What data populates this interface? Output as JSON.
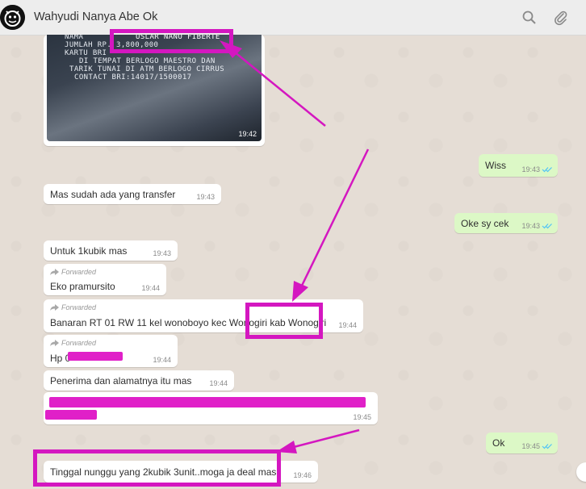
{
  "header": {
    "title": "Wahyudi Nanya Abe Ok",
    "icons": [
      "search-icon",
      "attach-icon"
    ]
  },
  "photo_message": {
    "lines": [
      "NAMA",
      "JUMLAH       RP.     3,800,000",
      "KARTU BRI",
      "DI TEMPAT BERLOGO MAESTRO DAN",
      "TARIK TUNAI DI ATM BERLOGO CIRRUS",
      "CONTACT BRI:14017/1500017"
    ],
    "name_fragment": "USLAR NANO FIBERTE",
    "time": "19:42"
  },
  "messages": [
    {
      "id": "m1",
      "direction": "out",
      "text": "Wiss",
      "time": "19:43",
      "status": "read"
    },
    {
      "id": "m2",
      "direction": "in",
      "text": "Mas sudah ada yang transfer",
      "time": "19:43"
    },
    {
      "id": "m3",
      "direction": "out",
      "text": "Oke sy cek",
      "time": "19:43",
      "status": "read"
    },
    {
      "id": "m4",
      "direction": "in",
      "text": "Untuk 1kubik mas",
      "time": "19:43"
    },
    {
      "id": "m5",
      "direction": "in",
      "forwarded": "Forwarded",
      "text": "Eko pramursito",
      "time": "19:44"
    },
    {
      "id": "m6",
      "direction": "in",
      "forwarded": "Forwarded",
      "text": "Banaran RT 01 RW 11 kel wonoboyo kec Wonogiri kab Wonogiri",
      "time": "19:44"
    },
    {
      "id": "m7",
      "direction": "in",
      "forwarded": "Forwarded",
      "text": "Hp 0",
      "time": "19:44",
      "redacted": true
    },
    {
      "id": "m8",
      "direction": "in",
      "text": "Penerima dan alamatnya itu mas",
      "time": "19:44"
    },
    {
      "id": "m9",
      "direction": "in",
      "text": "",
      "time": "19:45",
      "redacted": true
    },
    {
      "id": "m10",
      "direction": "out",
      "text": "Ok",
      "time": "19:45",
      "status": "read"
    },
    {
      "id": "m11",
      "direction": "in",
      "text": "Tinggal nunggu yang 2kubik 3unit..moga ja deal mas",
      "time": "19:46"
    }
  ],
  "colors": {
    "chat_bg": "#e5ddd5",
    "outgoing": "#dcf8c6",
    "incoming": "#ffffff",
    "annotation": "#d417c0",
    "redaction": "#e020c8",
    "read_ticks": "#4fc3f7"
  }
}
